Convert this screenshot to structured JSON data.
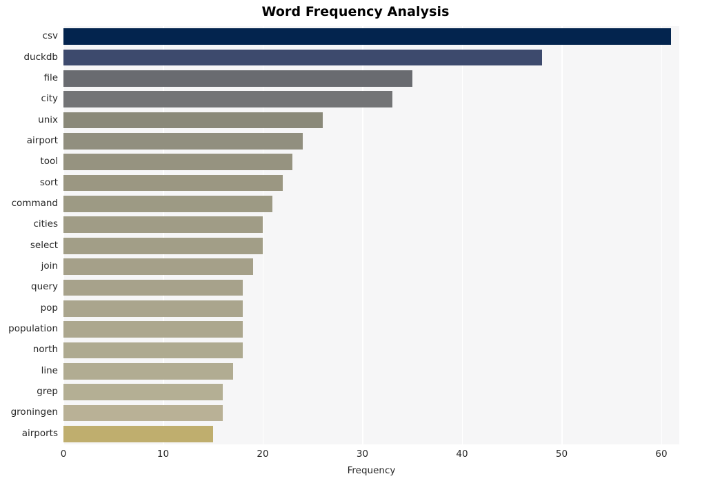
{
  "chart_data": {
    "type": "bar",
    "orientation": "horizontal",
    "title": "Word Frequency Analysis",
    "xlabel": "Frequency",
    "ylabel": "",
    "xlim": [
      0,
      61.8
    ],
    "xticks": [
      0,
      10,
      20,
      30,
      40,
      50,
      60
    ],
    "xtick_labels": [
      "0",
      "10",
      "20",
      "30",
      "40",
      "50",
      "60"
    ],
    "grid": "vertical-white-on-light-gray",
    "legend": "none",
    "categories": [
      "csv",
      "duckdb",
      "file",
      "city",
      "unix",
      "airport",
      "tool",
      "sort",
      "command",
      "cities",
      "select",
      "join",
      "query",
      "pop",
      "population",
      "north",
      "line",
      "grep",
      "groningen",
      "airports"
    ],
    "values": [
      61,
      48,
      35,
      33,
      26,
      24,
      23,
      22,
      21,
      20,
      20,
      19,
      18,
      18,
      18,
      18,
      17,
      16,
      16,
      15
    ],
    "bar_colors": [
      "#03244e",
      "#3d4a6d",
      "#696b70",
      "#737476",
      "#8a8979",
      "#918f7f",
      "#969380",
      "#9b9782",
      "#9d9a84",
      "#a09c86",
      "#a29e87",
      "#a5a089",
      "#a7a28b",
      "#aaa58d",
      "#aca78e",
      "#aeaa90",
      "#b1ac92",
      "#b4af94",
      "#b9b196",
      "#bfae6e"
    ],
    "plot_background": "#f6f6f7",
    "gridline_color": "#ffffff",
    "text_color": "#262626",
    "figure_background": "#ffffff"
  }
}
